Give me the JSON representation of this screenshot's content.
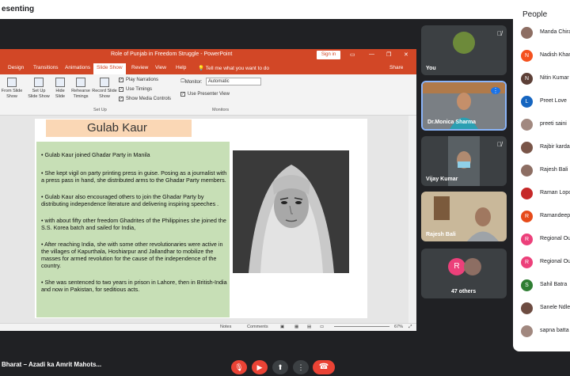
{
  "topbar": {
    "label": "esenting"
  },
  "ppt": {
    "window_title": "Role of Punjab in Freedom Struggle  -  PowerPoint",
    "sign_in": "Sign in",
    "tabs": [
      "Design",
      "Transitions",
      "Animations",
      "Slide Show",
      "Review",
      "View",
      "Help"
    ],
    "active_tab": "Slide Show",
    "tell_me": "Tell me what you want to do",
    "share": "Share",
    "ribbon": {
      "from_slide": "From Slide Show",
      "setup_show": "Set Up Slide Show",
      "hide_slide": "Hide Slide",
      "rehearse": "Rehearse Timings",
      "record": "Record Slide Show",
      "play_narrations": "Play Narrations",
      "use_timings": "Use Timings",
      "show_media": "Show Media Controls",
      "setup_group": "Set Up",
      "monitor_label": "Monitor:",
      "monitor_value": "Automatic",
      "presenter_view": "Use Presenter View",
      "monitors_group": "Monitors"
    },
    "slide": {
      "title": "Gulab Kaur",
      "bullets": [
        "Gulab Kaur joined Ghadar Party in Manila",
        "She kept vigil on party printing press in guise. Posing as a journalist with a press pass in hand, she distributed arms to the Ghadar Party members.",
        "Gulab Kaur also encouraged others to join the Ghadar Party by distributing independence literature and delivering inspiring speeches .",
        "with about fifty other freedom Ghadrites of the Philippines she joined the S.S. Korea batch and sailed for India,",
        "After reaching India, she with some other revolutionaries were active in the villages of Kapurthala, Hoshiarpur and Jallandhar to mobilize the masses for armed revolution for the cause of the independence of the country.",
        "She was sentenced to two years in prison in Lahore, then in British-India and now in Pakistan, for seditious acts."
      ]
    },
    "status": {
      "notes": "Notes",
      "comments": "Comments",
      "zoom": "67%"
    }
  },
  "tiles": {
    "you": "You",
    "monica": "Dr.Monica Sharma",
    "vijay": "Vijay Kumar",
    "rajesh": "Rajesh Bali",
    "others": "47 others",
    "others_initial": "R"
  },
  "people": {
    "title": "People",
    "list": [
      {
        "name": "Manda Chira",
        "initial": "",
        "color": "#8d6e63"
      },
      {
        "name": "Nadish Khan",
        "initial": "N",
        "color": "#f4511e"
      },
      {
        "name": "Nitin Kumar",
        "initial": "N",
        "color": "#5d4037"
      },
      {
        "name": "Preet Love",
        "initial": "L",
        "color": "#1565c0"
      },
      {
        "name": "preeti saini",
        "initial": "",
        "color": "#a1887f"
      },
      {
        "name": "Rajbir kardan",
        "initial": "",
        "color": "#795548"
      },
      {
        "name": "Rajesh Bali",
        "initial": "",
        "color": "#8d6e63"
      },
      {
        "name": "Raman Lopo",
        "initial": "",
        "color": "#c62828"
      },
      {
        "name": "Ramandeep",
        "initial": "R",
        "color": "#e64a19"
      },
      {
        "name": "Regional Ou",
        "initial": "R",
        "color": "#ec407a"
      },
      {
        "name": "Regional Ou",
        "initial": "R",
        "color": "#ec407a"
      },
      {
        "name": "Sahil Batra",
        "initial": "S",
        "color": "#2e7d32"
      },
      {
        "name": "Sanele Ndlel",
        "initial": "",
        "color": "#6d4c41"
      },
      {
        "name": "sapna batta",
        "initial": "",
        "color": "#a1887f"
      }
    ]
  },
  "bottom": {
    "meeting_name": "Bharat – Azadi ka Amrit Mahots..."
  }
}
